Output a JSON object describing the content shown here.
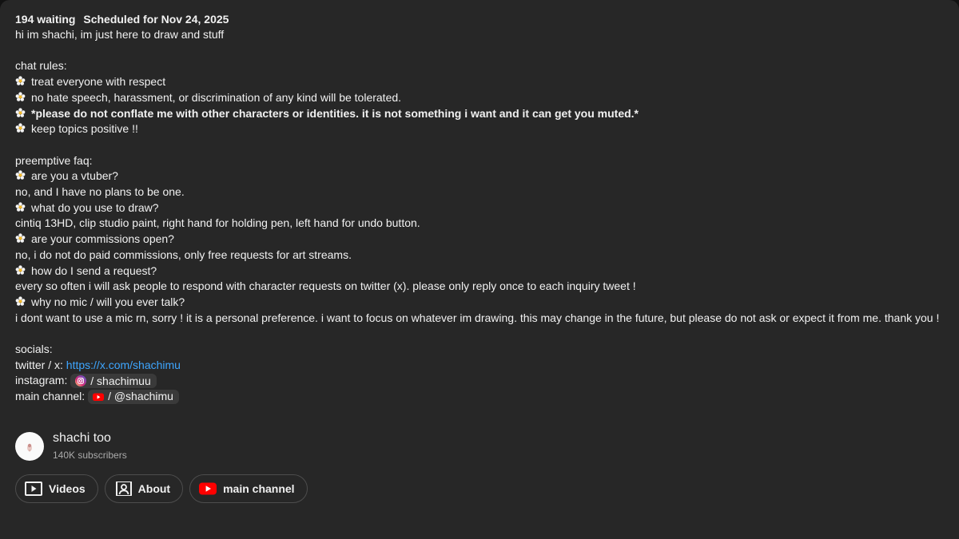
{
  "stream": {
    "waiting": "194 waiting",
    "scheduled": "Scheduled for Nov 24, 2025"
  },
  "description": {
    "intro": "hi im shachi, im just here to draw and stuff",
    "rules_heading": "chat rules:",
    "rules": [
      "treat everyone with respect",
      "no hate speech, harassment, or discrimination of any kind will be tolerated.",
      "*please do not conflate me with other characters or identities. it is not something i want and it can get you muted.*",
      "keep topics positive !!"
    ],
    "faq_heading": "preemptive faq:",
    "faq": [
      {
        "q": "are you a vtuber?",
        "a": "no, and I have no plans to be one."
      },
      {
        "q": "what do you use to draw?",
        "a": "cintiq 13HD, clip studio paint, right hand for holding pen, left hand for undo button."
      },
      {
        "q": "are your commissions open?",
        "a": "no, i do not do paid commissions, only free requests for art streams."
      },
      {
        "q": "how do I send a request?",
        "a": "every so often i will ask people to respond with character requests on twitter (x). please only reply once to each inquiry tweet !"
      },
      {
        "q": "why no mic / will you ever talk?",
        "a": "i dont want to use a mic rn, sorry ! it is a personal preference. i want to focus on whatever im drawing. this may change in the future, but please do not ask or expect it from me. thank you !"
      }
    ],
    "socials_heading": "socials:",
    "twitter_label": "twitter / x: ",
    "twitter_link": "https://x.com/shachimu",
    "instagram_label": "instagram: ",
    "instagram_chip": "/ shachimuu",
    "main_label": "main channel: ",
    "main_chip": "/ @shachimu"
  },
  "channel": {
    "name": "shachi too",
    "subscribers": "140K subscribers"
  },
  "buttons": {
    "videos": "Videos",
    "about": "About",
    "main_channel": "main channel"
  },
  "icons": {
    "bullet": "flower-emoji-icon",
    "instagram": "instagram-icon",
    "youtube": "youtube-icon",
    "videos": "play-square-icon",
    "about": "person-badge-icon"
  },
  "colors": {
    "background": "#272727",
    "link": "#3ea6ff",
    "youtube_red": "#ff0000",
    "subtext": "#aaaaaa"
  }
}
